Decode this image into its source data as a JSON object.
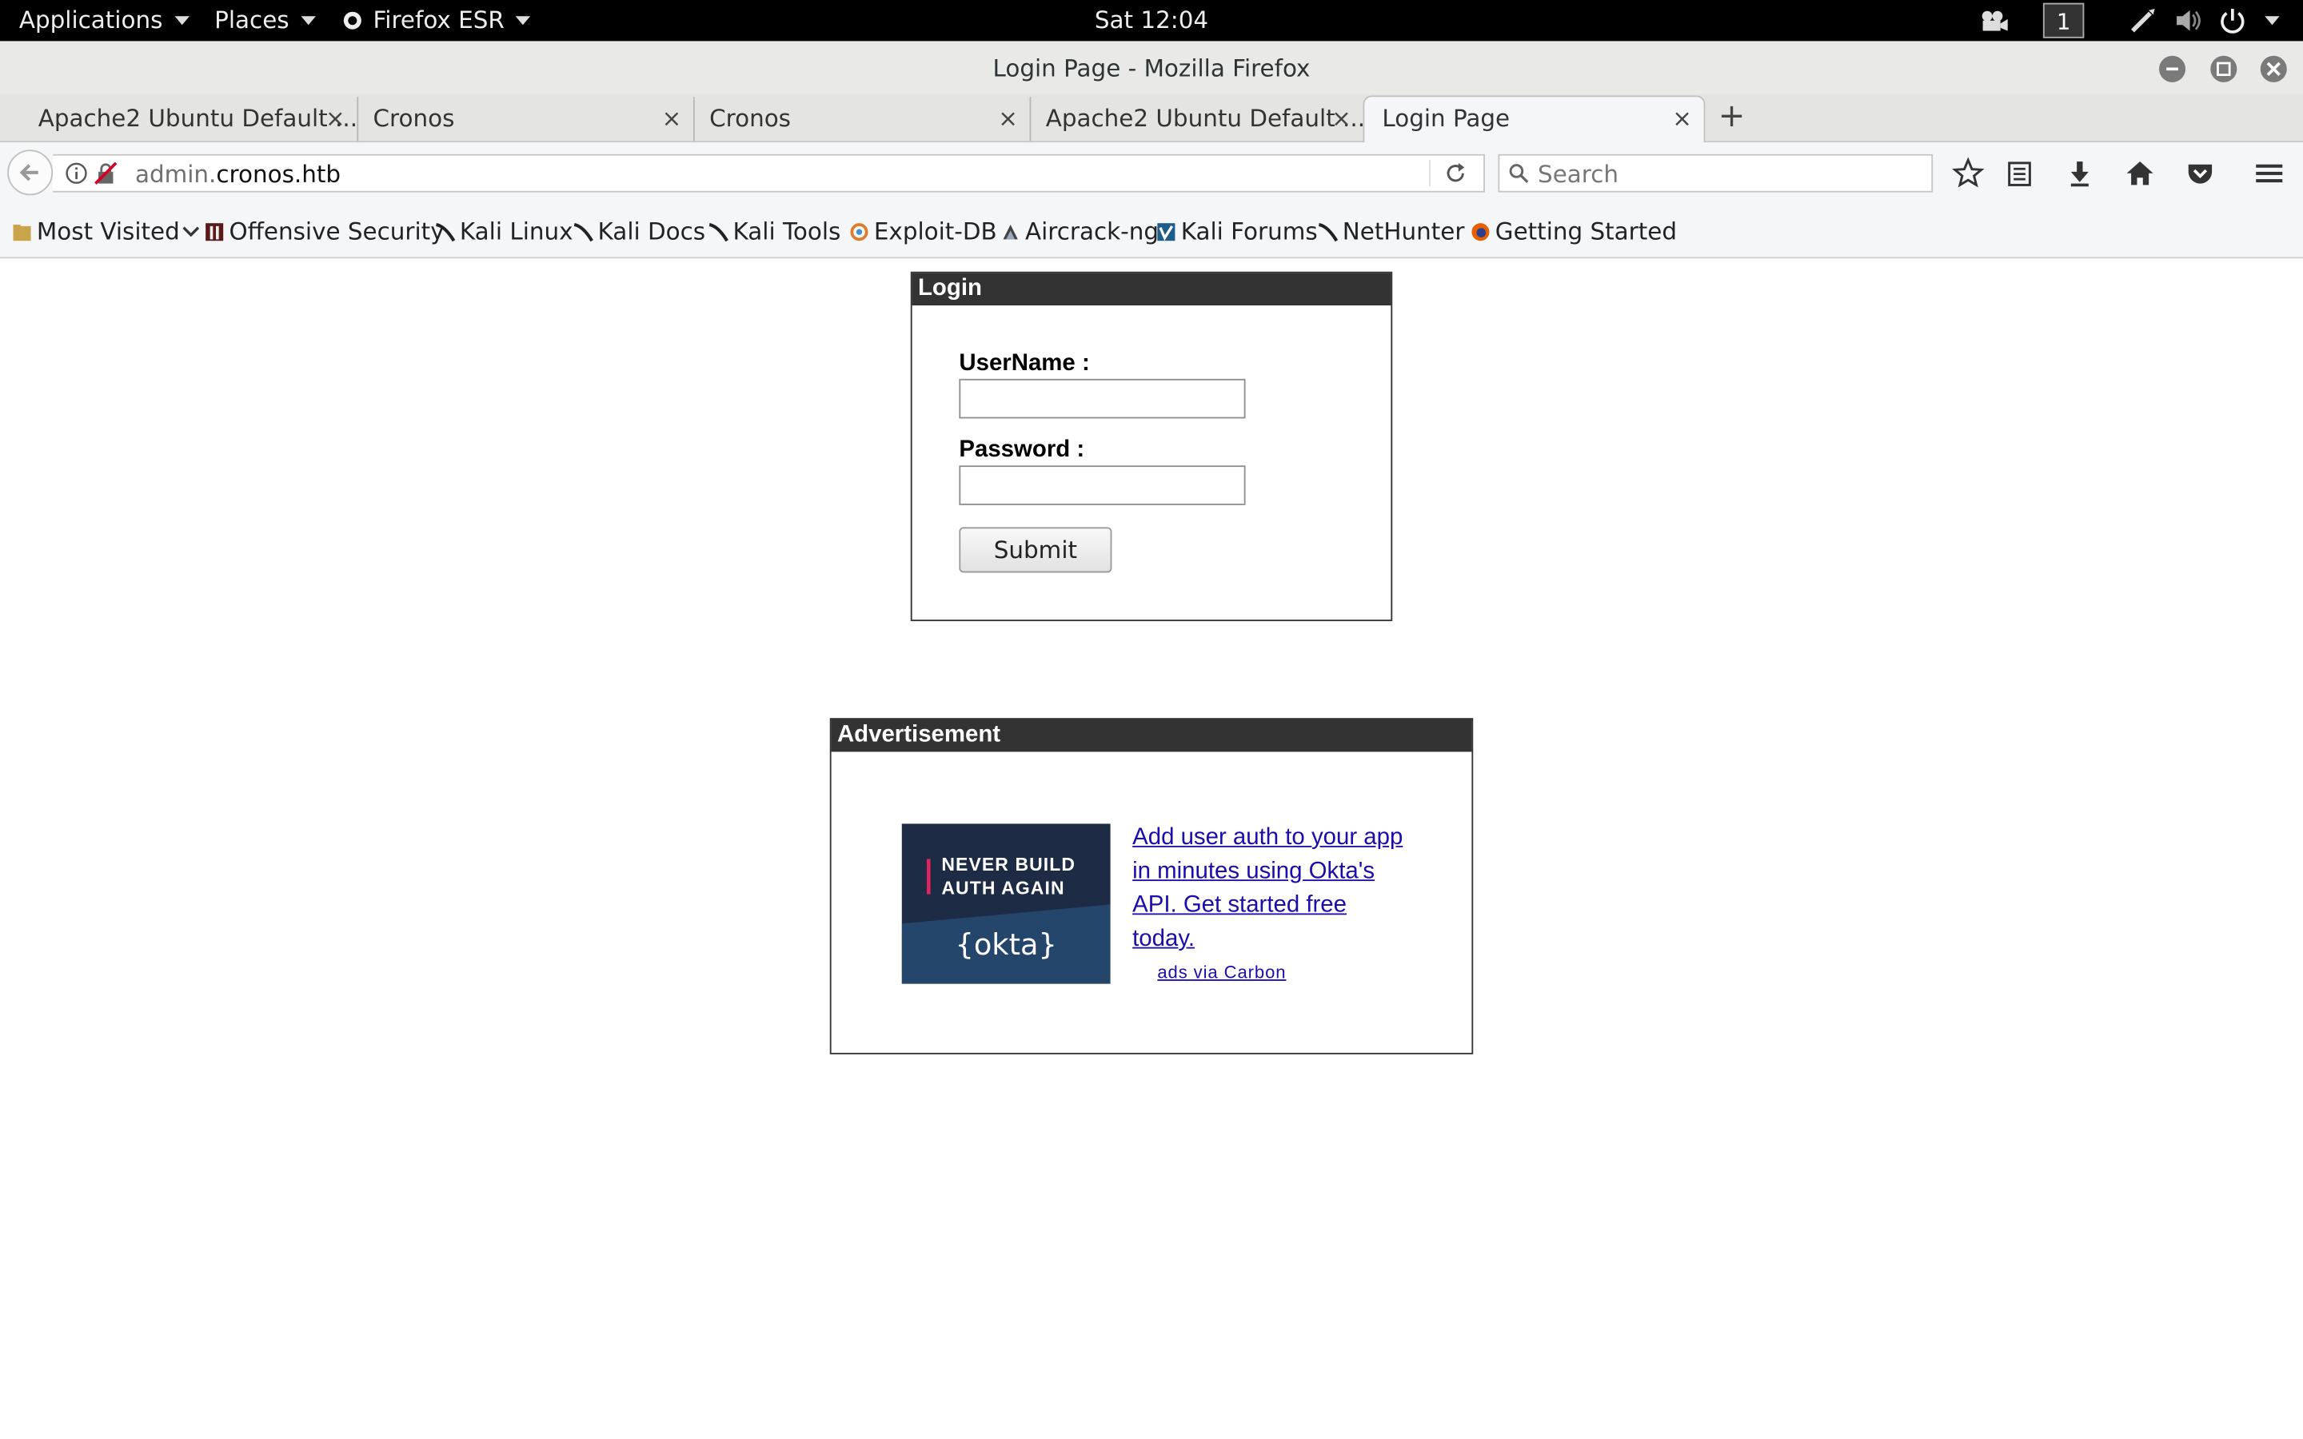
{
  "system": {
    "applications_label": "Applications",
    "places_label": "Places",
    "app_menu_label": "Firefox ESR",
    "clock": "Sat 12:04",
    "workspace": "1"
  },
  "window": {
    "title": "Login Page - Mozilla Firefox"
  },
  "tabs": [
    {
      "label": "Apache2 Ubuntu Default ...",
      "close": "×"
    },
    {
      "label": "Cronos",
      "close": "×"
    },
    {
      "label": "Cronos",
      "close": "×"
    },
    {
      "label": "Apache2 Ubuntu Default ...",
      "close": "×"
    },
    {
      "label": "Login Page",
      "close": "×",
      "active": true
    }
  ],
  "new_tab_label": "+",
  "navbar": {
    "url_subdomain": "admin.",
    "url_domain": "cronos.htb",
    "search_placeholder": "Search"
  },
  "bookmarks": [
    {
      "label": "Most Visited",
      "icon": "folder-icon"
    },
    {
      "label": "Offensive Security",
      "icon": "offsec-icon"
    },
    {
      "label": "Kali Linux",
      "icon": "kali-dragon-icon"
    },
    {
      "label": "Kali Docs",
      "icon": "kali-dragon-icon"
    },
    {
      "label": "Kali Tools",
      "icon": "kali-dragon-icon"
    },
    {
      "label": "Exploit-DB",
      "icon": "exploit-db-icon"
    },
    {
      "label": "Aircrack-ng",
      "icon": "aircrack-icon"
    },
    {
      "label": "Kali Forums",
      "icon": "kali-forums-icon"
    },
    {
      "label": "NetHunter",
      "icon": "kali-dragon-icon"
    },
    {
      "label": "Getting Started",
      "icon": "firefox-icon"
    }
  ],
  "login": {
    "header": "Login",
    "username_label": "UserName :",
    "username_value": "",
    "password_label": "Password :",
    "password_value": "",
    "submit_label": "Submit"
  },
  "ad": {
    "header": "Advertisement",
    "image_line1": "NEVER BUILD",
    "image_line2": "AUTH AGAIN",
    "image_brand": "{okta}",
    "link_text": "Add user auth to your app in minutes using Okta's API. Get started free today.",
    "credit": "ads via Carbon"
  },
  "colors": {
    "topbar_bg": "#000000",
    "box_header_bg": "#333333",
    "link": "#1a0dab",
    "ad_image_bg": "#1d2b45"
  }
}
